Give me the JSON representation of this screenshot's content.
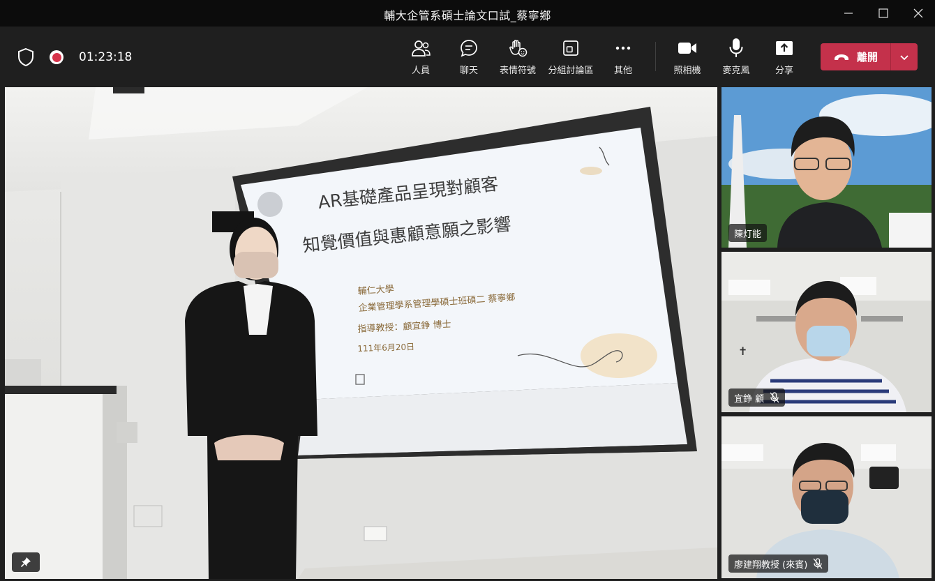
{
  "window": {
    "title": "輔大企管系碩士論文口試_蔡寧鄉"
  },
  "meeting": {
    "elapsed": "01:23:18"
  },
  "toolbar": {
    "people": "人員",
    "chat": "聊天",
    "reactions": "表情符號",
    "rooms": "分組討論區",
    "more": "其他",
    "camera": "照相機",
    "mic": "麥克風",
    "share": "分享",
    "leave": "離開"
  },
  "slide": {
    "title_line1": "AR基礎產品呈現對顧客",
    "title_line2": "知覺價值與惠顧意願之影響",
    "school": "輔仁大學",
    "author": "企業管理學系管理學碩士班碩二 蔡寧鄉",
    "advisor": "指導教授：顧宜錚 博士",
    "date": "111年6月20日"
  },
  "participants": [
    {
      "name": "陳灯能",
      "muted": false
    },
    {
      "name": "宜錚 顧",
      "muted": true
    },
    {
      "name": "廖建翔教授 (來賓)",
      "muted": true
    }
  ],
  "colors": {
    "leave_red": "#c4314b",
    "record_red": "#d6334b",
    "toolbar_bg": "#1f1f1f"
  }
}
